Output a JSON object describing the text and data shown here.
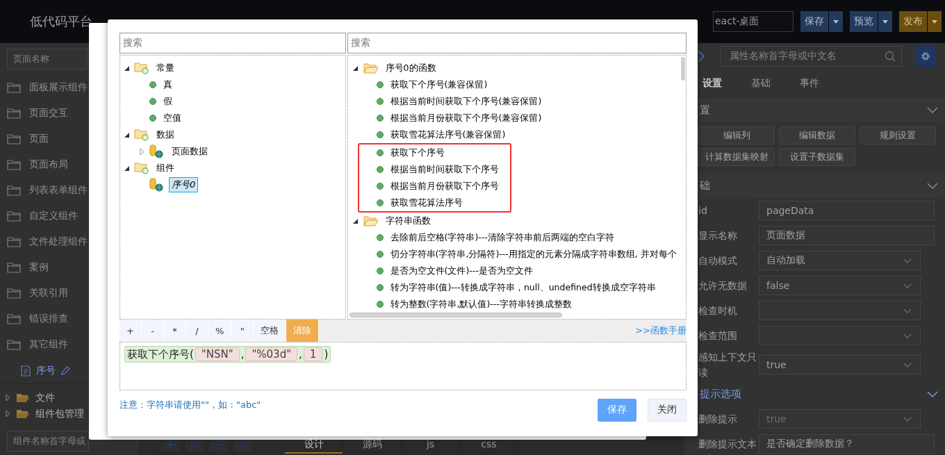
{
  "topbar": {
    "logo": "低代码平台",
    "platform": "eact-桌面",
    "buttons": [
      {
        "label": "保存",
        "kind": "primary"
      },
      {
        "label": "预览",
        "kind": "primary"
      },
      {
        "label": "发布",
        "kind": "warning"
      }
    ]
  },
  "sidebar": {
    "search_placeholder": "页面名称",
    "folders": [
      "面板展示组件",
      "页面交互",
      "页面",
      "页面布局",
      "列表表单组件",
      "自定义组件",
      "文件处理组件",
      "案例",
      "关联引用",
      "错误排查",
      "其它组件"
    ],
    "current_page": "序号",
    "tree": [
      {
        "label": "文件",
        "expanded": false
      },
      {
        "label": "组件包管理",
        "expanded": false
      }
    ],
    "bottom_search_placeholder": "组件名称首字母或"
  },
  "editor": {
    "tabs": [
      {
        "label": "设计",
        "selected": true
      },
      {
        "label": "源码",
        "selected": false
      },
      {
        "label": "js",
        "selected": false
      },
      {
        "label": "css",
        "selected": false
      }
    ]
  },
  "properties": {
    "search_placeholder": "属性名称首字母或中文名",
    "tabs": [
      {
        "label": "设置",
        "selected": true
      },
      {
        "label": "基础",
        "selected": false
      },
      {
        "label": "事件",
        "selected": false
      }
    ],
    "sections": [
      {
        "title": "置",
        "kind": "buttons",
        "expanded": true,
        "buttons": [
          "编辑列",
          "编辑数据",
          "规则设置",
          "计算数据集映射",
          "设置子数据集"
        ]
      },
      {
        "title": "础",
        "kind": "form",
        "expanded": true,
        "fields": [
          {
            "label": "id",
            "kind": "input",
            "value": "pageData",
            "disabled": false
          },
          {
            "label": "显示名称",
            "kind": "input",
            "value": "页面数据",
            "disabled": false
          },
          {
            "label": "自动模式",
            "kind": "select",
            "value": "自动加载",
            "disabled": false
          },
          {
            "label": "允许无数据",
            "kind": "select",
            "value": "false",
            "disabled": false
          },
          {
            "label": "检查时机",
            "kind": "select",
            "disabled": false
          },
          {
            "label": "检查范围",
            "kind": "select",
            "disabled": false
          },
          {
            "label": "感知上下文只读",
            "kind": "select",
            "value": "true",
            "disabled": false
          }
        ]
      },
      {
        "title": "提示选项",
        "kind": "form",
        "expanded": true,
        "fields": [
          {
            "label": "删除提示",
            "kind": "select",
            "value": "true",
            "disabled": true
          },
          {
            "label": "删除提示文本",
            "kind": "input",
            "value": "是否确定删除数据？",
            "disabled": false
          }
        ]
      }
    ]
  },
  "dialog": {
    "variables_search_placeholder": "搜索",
    "functions_search_placeholder": "搜索",
    "variables": [
      {
        "label": "常量",
        "kind": "folder",
        "expanded": true,
        "selected": false,
        "children": [
          {
            "label": "真",
            "kind": "item",
            "selected": false
          },
          {
            "label": "假",
            "kind": "item",
            "selected": false
          },
          {
            "label": "空值",
            "kind": "item",
            "selected": false
          }
        ]
      },
      {
        "label": "数据",
        "kind": "folder",
        "expanded": true,
        "selected": false,
        "children": [
          {
            "label": "页面数据",
            "kind": "dataset",
            "expanded": false,
            "selected": false
          }
        ]
      },
      {
        "label": "组件",
        "kind": "folder",
        "expanded": true,
        "selected": false,
        "children": [
          {
            "label": "序号0",
            "kind": "dataset",
            "selected": true
          }
        ]
      }
    ],
    "functions": [
      {
        "label": "序号0的函数",
        "kind": "folder",
        "expanded": true,
        "selected": false,
        "children": [
          {
            "label": "获取下个序号(兼容保留)",
            "kind": "item",
            "selected": false,
            "highlighted": false
          },
          {
            "label": "根据当前时间获取下个序号(兼容保留)",
            "kind": "item",
            "selected": false,
            "highlighted": false
          },
          {
            "label": "根据当前月份获取下个序号(兼容保留)",
            "kind": "item",
            "selected": false,
            "highlighted": false
          },
          {
            "label": "获取雪花算法序号(兼容保留)",
            "kind": "item",
            "selected": false,
            "highlighted": false
          },
          {
            "label": "获取下个序号",
            "kind": "item",
            "selected": false,
            "highlighted": true
          },
          {
            "label": "根据当前时间获取下个序号",
            "kind": "item",
            "selected": false,
            "highlighted": true
          },
          {
            "label": "根据当前月份获取下个序号",
            "kind": "item",
            "selected": false,
            "highlighted": true
          },
          {
            "label": "获取雪花算法序号",
            "kind": "item",
            "selected": false,
            "highlighted": true
          }
        ]
      },
      {
        "label": "字符串函数",
        "kind": "folder",
        "expanded": true,
        "selected": false,
        "children": [
          {
            "label": "去除前后空格(字符串)---清除字符串前后两端的空白字符",
            "kind": "item",
            "selected": false,
            "highlighted": false
          },
          {
            "label": "切分字符串(字符串,分隔符)---用指定的元素分隔成字符串数组, 并对每个",
            "kind": "item",
            "selected": false,
            "highlighted": false
          },
          {
            "label": "是否为空文件(文件)---是否为空文件",
            "kind": "item",
            "selected": false,
            "highlighted": false
          },
          {
            "label": "转为字符串(值)---转换成字符串，null、undefined转换成空字符串",
            "kind": "item",
            "selected": false,
            "highlighted": false
          },
          {
            "label": "转为整数(字符串,默认值)---字符串转换成整数",
            "kind": "item",
            "selected": false,
            "highlighted": false
          }
        ]
      }
    ],
    "operators": [
      "+",
      "-",
      "*",
      "/",
      "%",
      "\"",
      "空格"
    ],
    "clear_button": "清除",
    "manual_link": ">>函数手册",
    "expression": {
      "function": "获取下个序号",
      "open": "(",
      "args": [
        "\"NSN\"",
        "\"%03d\"",
        "1"
      ],
      "separator": ",",
      "close": ")"
    },
    "note": "注意：字符串请使用\"\"，如：\"abc\"",
    "buttons": [
      {
        "label": "保存",
        "kind": "primary"
      },
      {
        "label": "关闭",
        "kind": "default"
      }
    ]
  }
}
